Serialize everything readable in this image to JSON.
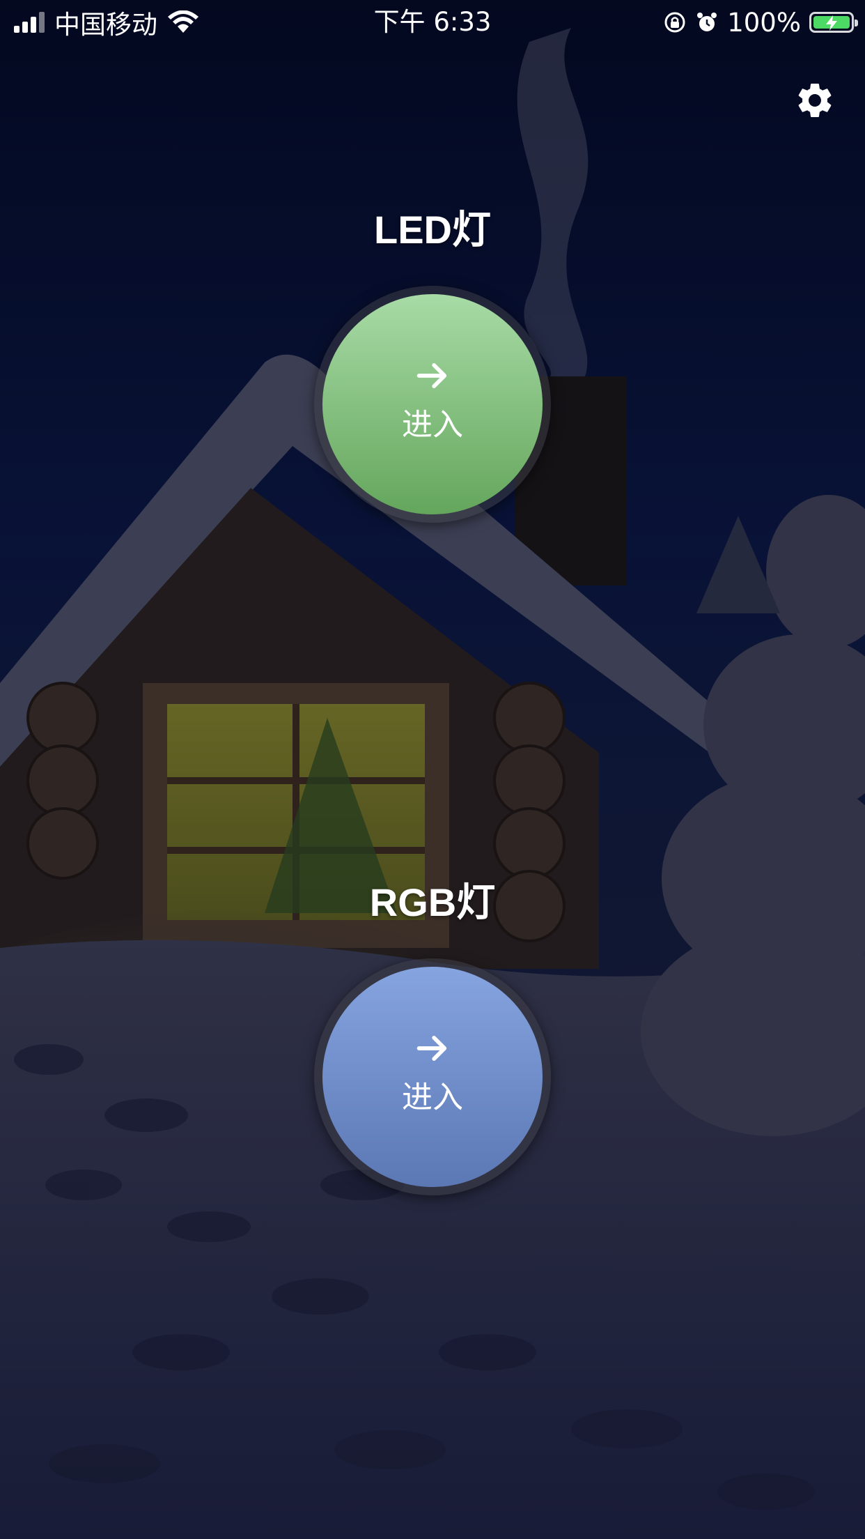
{
  "status_bar": {
    "carrier": "中国移动",
    "time": "下午 6:33",
    "battery": "100%",
    "icons": [
      "signal-icon",
      "wifi-icon",
      "rotation-lock-icon",
      "alarm-icon",
      "battery-charging-icon"
    ]
  },
  "settings": {
    "icon": "gear-icon"
  },
  "devices": [
    {
      "title": "LED灯",
      "button_label": "进入",
      "icon": "arrow-right-icon",
      "color_top": "#a8dba6",
      "color_bottom": "#64a65c"
    },
    {
      "title": "RGB灯",
      "button_label": "进入",
      "icon": "arrow-right-icon",
      "color_top": "#86a4e0",
      "color_bottom": "#5b78b4"
    }
  ],
  "colors": {
    "battery_fill": "#4cd964",
    "text": "#ffffff"
  }
}
